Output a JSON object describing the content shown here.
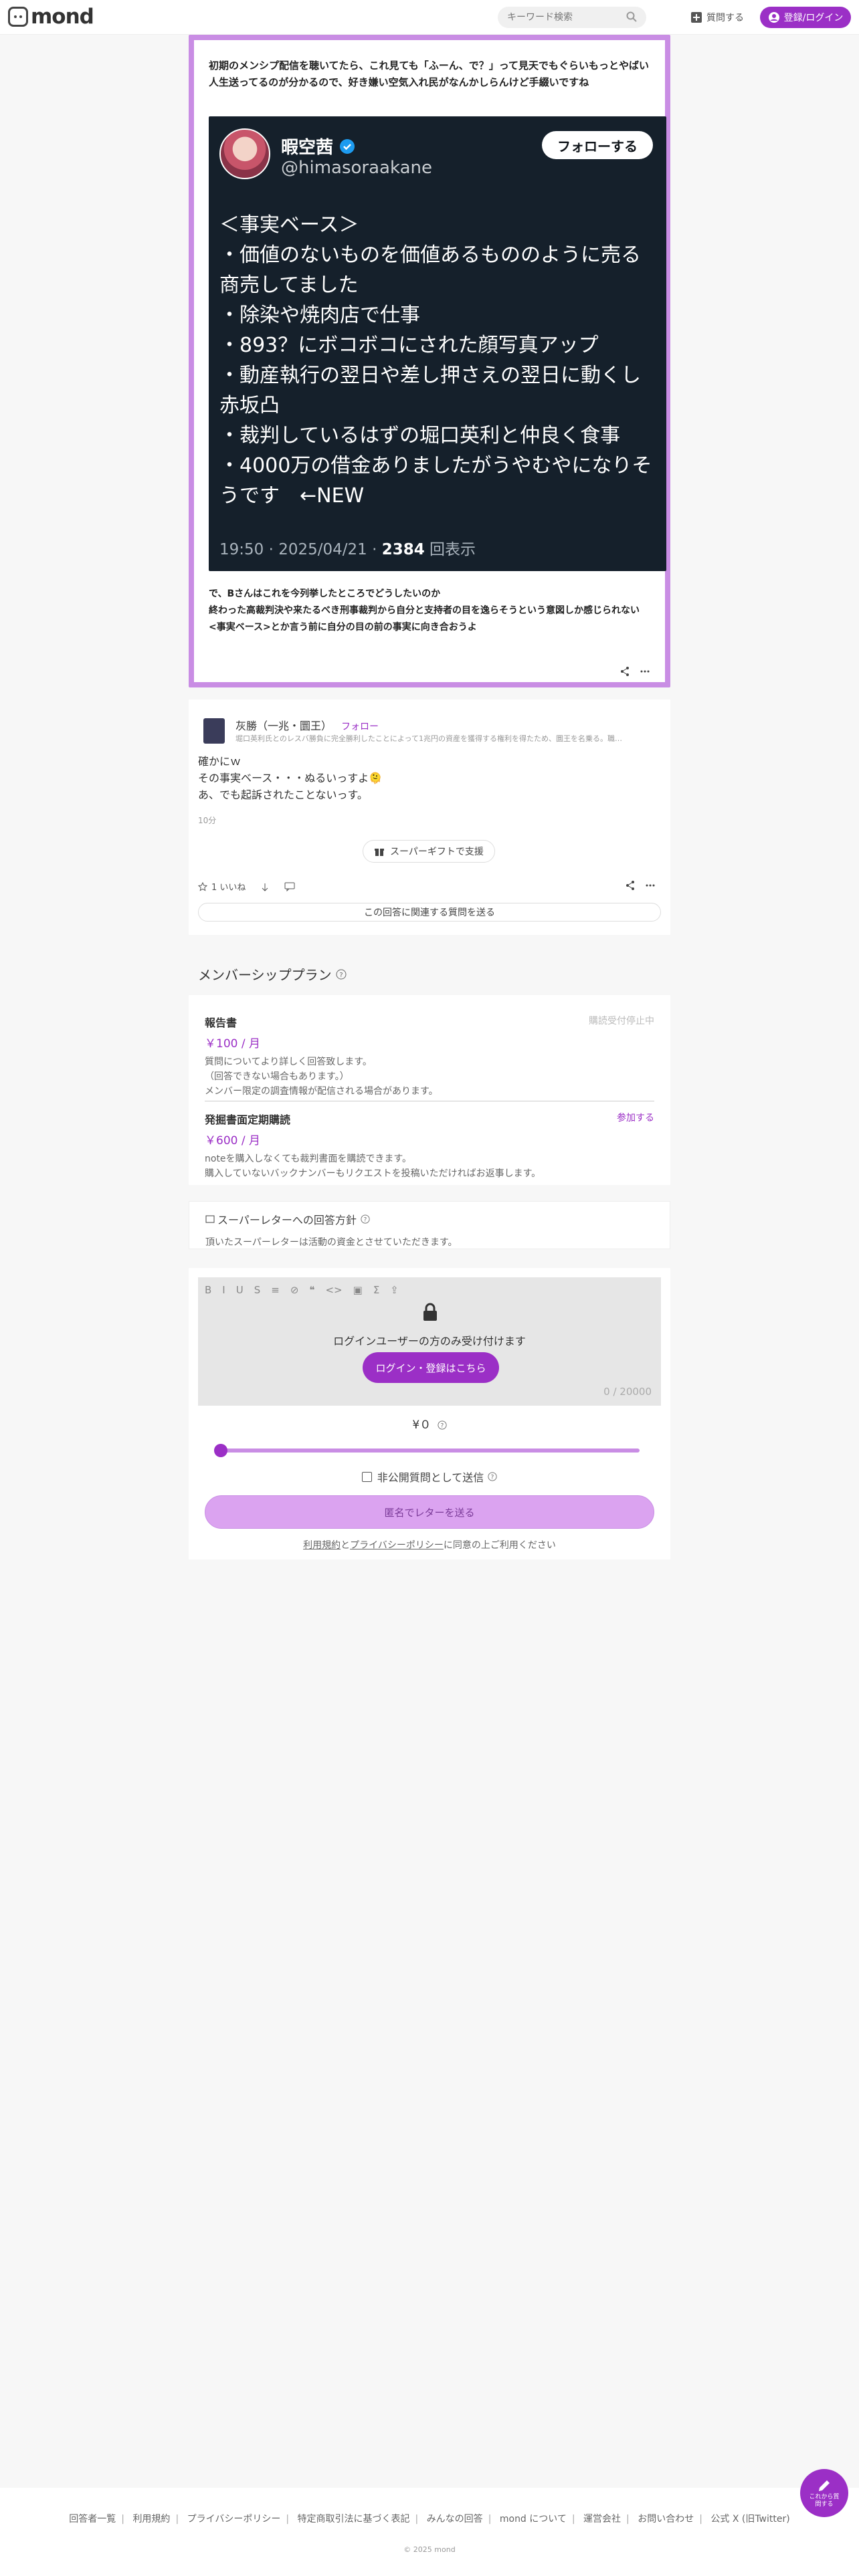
{
  "header": {
    "logo": "mond",
    "search_placeholder": "キーワード検索",
    "ask_label": "質問する",
    "login_label": "登録/ログイン"
  },
  "question": {
    "text": "初期のメンシプ配信を聴いてたら、これ見ても「ふーん、で？」って見天でもぐらいもっとやばい人生送ってるのが分かるので、好き嫌い空気入れ民がなんかしらんけど手綴いですね",
    "tweet": {
      "name": "暇空茜",
      "handle": "@himasoraakane",
      "follow_label": "フォローする",
      "lines": [
        "＜事実ベース＞",
        "・価値のないものを価値あるもののように売る商売してました",
        "・除染や焼肉店で仕事",
        "・893？にボコボコにされた顔写真アップ",
        "・動産執行の翌日や差し押さえの翌日に動くし赤坂凸",
        "・裁判しているはずの堀口英利と仲良く食事",
        "・4000万の借金ありましたがうやむやになりそうです　←NEW"
      ],
      "time": "19:50 · 2025/04/21 · ",
      "views": "2384",
      "views_label": " 回表示"
    },
    "footer_lines": [
      "で、Bさんはこれを今列挙したところでどうしたいのか",
      "終わった高裁判決や来たるべき刑事裁判から自分と支持者の目を逸らそうという意図しか感じられない",
      "<事実ベース>とか言う前に自分の目の前の事実に向き合おうよ"
    ]
  },
  "answer": {
    "name": "灰勝（一兆・圜王）",
    "follow_label": "フォロー",
    "bio": "堀口英利氏とのレスバ勝負に完全勝利したことによって1兆円の資産を獲得する権利を得たため、圜王を名乗る。職…",
    "lines": [
      "確かにｗ",
      "その事実ベース・・・ぬるいっすよ🫠",
      "あ、でも起訴されたことないっす。"
    ],
    "time": "10分",
    "gift_label": "スーパーギフトで支援",
    "like_label": "1 いいね",
    "related_label": "この回答に関連する質問を送る"
  },
  "membership": {
    "title": "メンバーシッププラン",
    "plans": [
      {
        "name": "報告書",
        "price": "￥100 / 月",
        "status": "購読受付停止中",
        "desc": [
          "質問についてより詳しく回答致します。",
          "（回答できない場合もあります。）",
          "メンバー限定の調査情報が配信される場合があります。"
        ]
      },
      {
        "name": "発掘書面定期購読",
        "price": "￥600 / 月",
        "status": "参加する",
        "desc": [
          "noteを購入しなくても裁判書面を購読できます。",
          "購入していないバックナンバーもリクエストを投稿いただければお返事します。"
        ]
      }
    ]
  },
  "superletter": {
    "title": "スーパーレターへの回答方針",
    "desc": "頂いたスーパーレターは活動の資金とさせていただきます。"
  },
  "form": {
    "toolbar": [
      "B",
      "I",
      "U",
      "S",
      "≡",
      "⊘",
      "❝",
      "<>",
      "▣",
      "Σ",
      "⇪"
    ],
    "login_message": "ログインユーザーの方のみ受け付けます",
    "login_button": "ログイン・登録はこちら",
    "counter": "0 / 20000",
    "amount": "¥０",
    "amount_fraction": 0,
    "private_label": "非公開質問として送信",
    "send_label": "匿名でレターを送る",
    "terms_link1": "利用規約",
    "terms_mid": "と",
    "terms_link2": "プライバシーポリシー",
    "terms_tail": "に同意の上ご利用ください"
  },
  "fab": {
    "label": "これから質問する"
  },
  "footer": {
    "links": [
      "回答者一覧",
      "利用規約",
      "プライバシーポリシー",
      "特定商取引法に基づく表記",
      "みんなの回答",
      "mond について",
      "運営会社",
      "お問い合わせ",
      "公式 X (旧Twitter)"
    ],
    "copyright": "© 2025 mond"
  },
  "colors": {
    "accent": "#9b2fc6",
    "accent_light": "#c98de4",
    "tweet_bg": "#15202b"
  }
}
